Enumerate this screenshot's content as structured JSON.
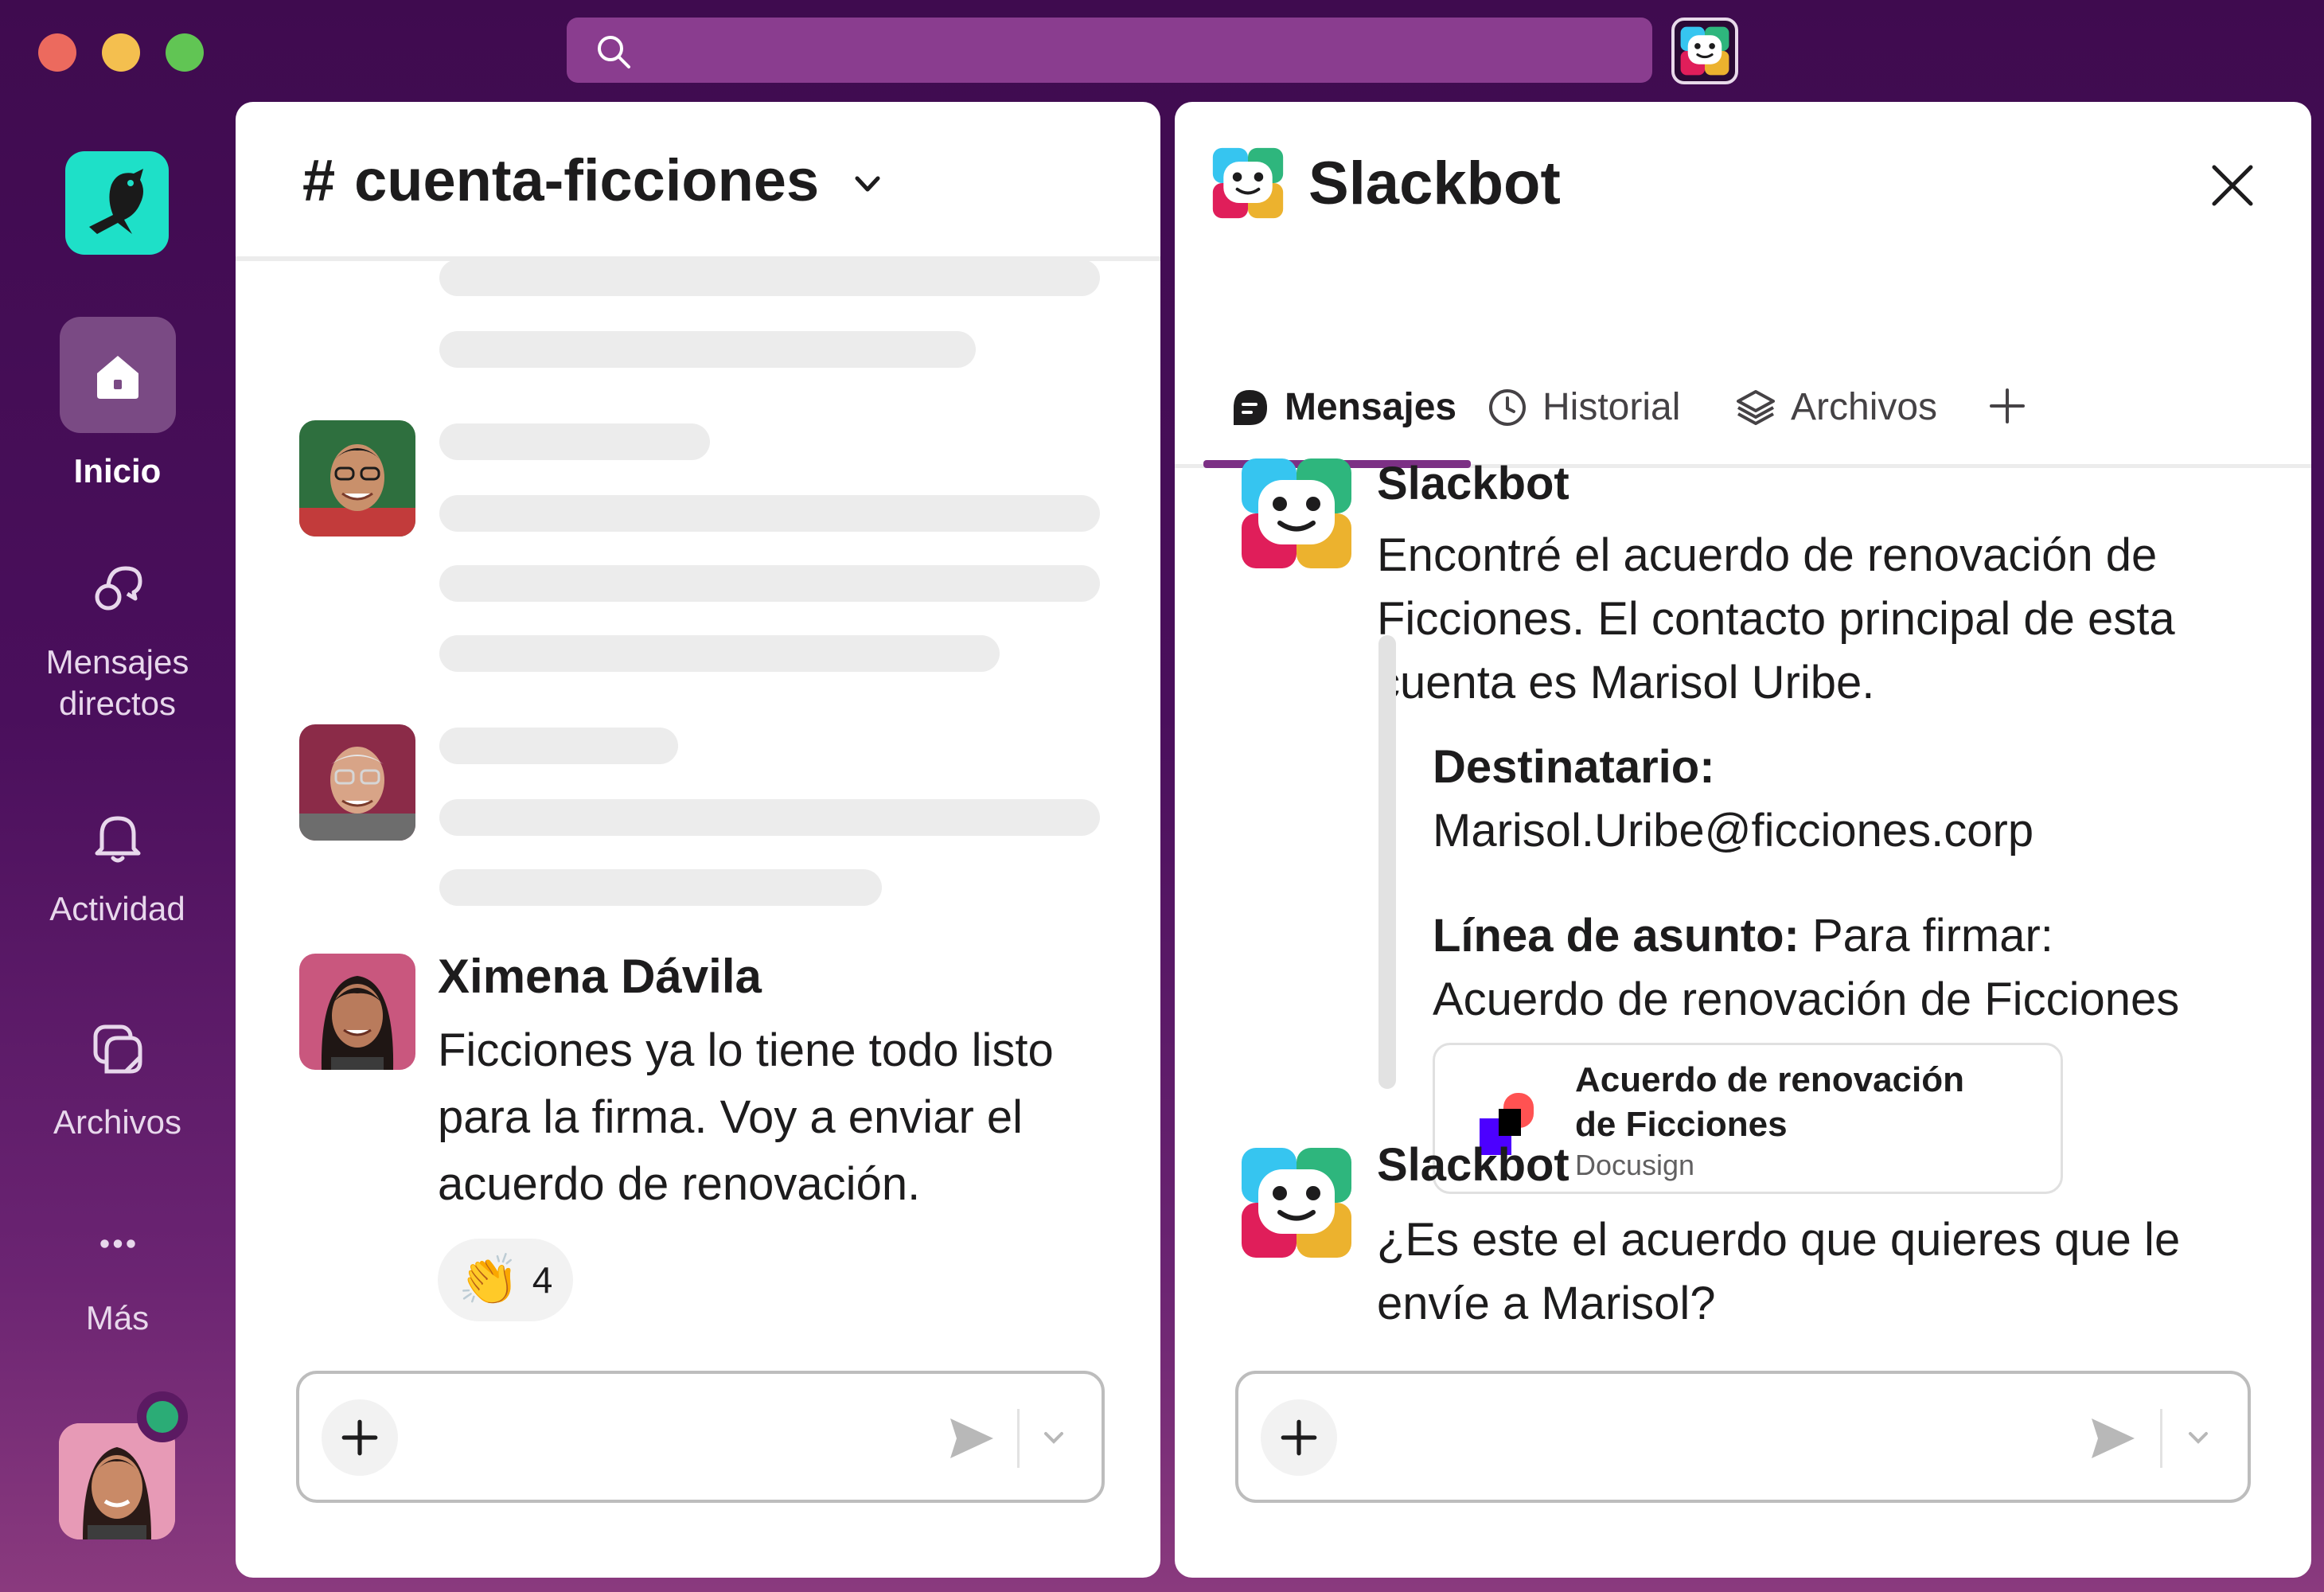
{
  "rail": {
    "items": [
      {
        "label": "Inicio"
      },
      {
        "label_line1": "Mensajes",
        "label_line2": "directos"
      },
      {
        "label": "Actividad"
      },
      {
        "label": "Archivos"
      },
      {
        "label": "Más"
      }
    ]
  },
  "channel": {
    "hash": "#",
    "name": "cuenta-ficciones"
  },
  "left_messages": {
    "author": "Ximena Dávila",
    "text_line1": "Ficciones ya lo tiene todo listo",
    "text_line2": "para la firma. Voy a enviar el",
    "text_line3": "acuerdo de renovación.",
    "reaction_emoji": "👏",
    "reaction_count": "4"
  },
  "slackbot_panel": {
    "title": "Slackbot",
    "tabs": [
      {
        "label": "Mensajes",
        "icon": "message-icon",
        "active": true
      },
      {
        "label": "Historial",
        "icon": "clock-icon",
        "active": false
      },
      {
        "label": "Archivos",
        "icon": "layers-icon",
        "active": false
      }
    ],
    "add_tab_icon": "plus-icon"
  },
  "bot_messages": [
    {
      "author": "Slackbot",
      "line1": "Encontré el acuerdo de renovación de",
      "line2": "Ficciones. El contacto principal de esta",
      "line3": "cuenta es Marisol Uribe.",
      "recipient_label": "Destinatario:",
      "recipient_value": "Marisol.Uribe@ficciones.corp",
      "subject_label": "Línea de asunto:",
      "subject_value_1": "Para firmar:",
      "subject_value_2": "Acuerdo de renovación de Ficciones",
      "file_name_1": "Acuerdo de renovación",
      "file_name_2": "de Ficciones",
      "file_source": "Docusign"
    },
    {
      "author": "Slackbot",
      "line1": "¿Es este el acuerdo que quieres que le",
      "line2": "envíe a Marisol?"
    }
  ],
  "colors": {
    "aubergine": "#4a0f5c",
    "accent_purple": "#7c3085",
    "presence_green": "#2bac76",
    "logo_teal": "#1ee0c8"
  }
}
